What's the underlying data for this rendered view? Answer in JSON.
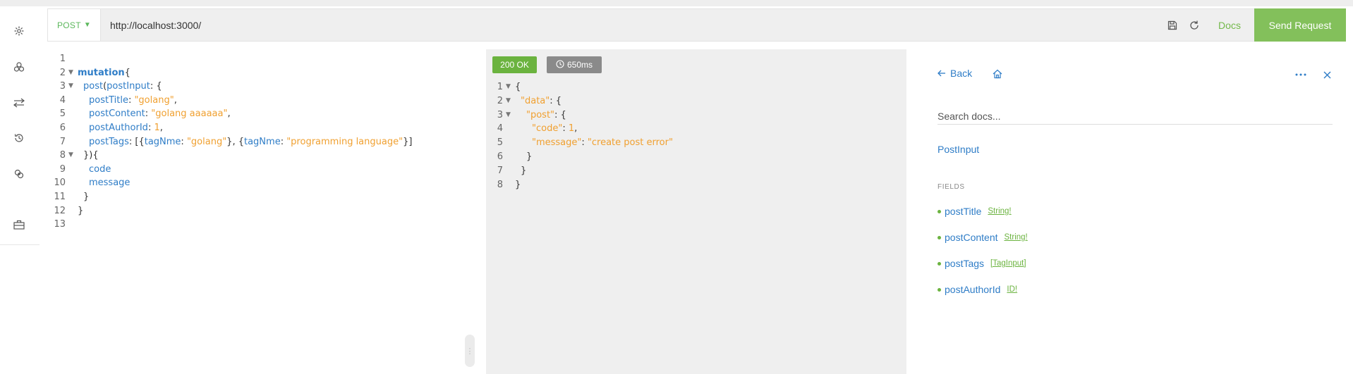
{
  "request": {
    "method_label": "POST",
    "url": "http://localhost:3000/",
    "docs_label": "Docs",
    "send_label": "Send Request"
  },
  "sidebar": {
    "icons": [
      "settings-icon",
      "schema-icon",
      "swap-icon",
      "history-icon",
      "plugins-icon",
      "toolbox-icon"
    ]
  },
  "query_lines": [
    {
      "n": "1",
      "t": ""
    },
    {
      "n": "2",
      "t": "mutation{"
    },
    {
      "n": "3",
      "t": "post(postInput: {"
    },
    {
      "n": "4",
      "t": "postTitle: \"golang\","
    },
    {
      "n": "5",
      "t": "postContent: \"golang aaaaaa\","
    },
    {
      "n": "6",
      "t": "postAuthorId: 1,"
    },
    {
      "n": "7",
      "t": "postTags: [{tagNme: \"golang\"}, {tagNme: \"programming language\"}]"
    },
    {
      "n": "8",
      "t": "}){"
    },
    {
      "n": "9",
      "t": "code"
    },
    {
      "n": "10",
      "t": "message"
    },
    {
      "n": "11",
      "t": "}"
    },
    {
      "n": "12",
      "t": "}"
    },
    {
      "n": "13",
      "t": ""
    }
  ],
  "response": {
    "status": "200 OK",
    "time": "650ms",
    "lines": [
      {
        "n": "1",
        "t": "{"
      },
      {
        "n": "2",
        "t": "\"data\": {"
      },
      {
        "n": "3",
        "t": "\"post\": {"
      },
      {
        "n": "4",
        "t": "\"code\": 1,"
      },
      {
        "n": "5",
        "t": "\"message\": \"create post error\""
      },
      {
        "n": "6",
        "t": "}"
      },
      {
        "n": "7",
        "t": "}"
      },
      {
        "n": "8",
        "t": "}"
      }
    ]
  },
  "docs": {
    "back_label": "Back",
    "search_placeholder": "Search docs...",
    "type_name": "PostInput",
    "fields_label": "FIELDS",
    "fields": [
      {
        "name": "postTitle",
        "type": "String!"
      },
      {
        "name": "postContent",
        "type": "String!"
      },
      {
        "name": "postTags",
        "type": "[TagInput]"
      },
      {
        "name": "postAuthorId",
        "type": "ID!"
      }
    ]
  },
  "colors": {
    "accent_green": "#83c05b",
    "link_blue": "#2f7dc7",
    "string_orange": "#f0a030"
  }
}
